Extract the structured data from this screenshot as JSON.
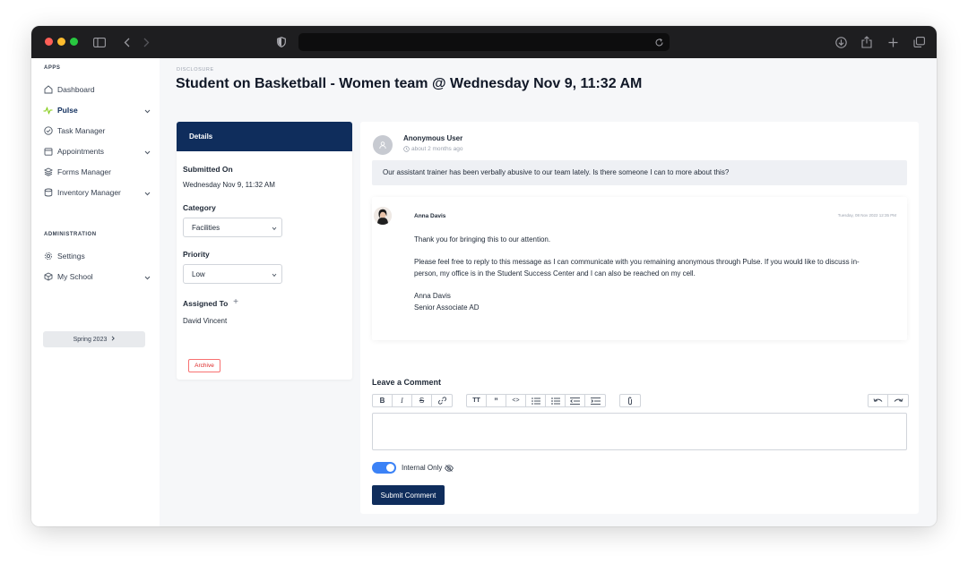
{
  "sidebar": {
    "apps_heading": "APPS",
    "items": [
      {
        "label": "Dashboard",
        "icon": "home-icon"
      },
      {
        "label": "Pulse",
        "icon": "pulse-icon"
      },
      {
        "label": "Task Manager",
        "icon": "check-circle-icon"
      },
      {
        "label": "Appointments",
        "icon": "calendar-icon"
      },
      {
        "label": "Forms Manager",
        "icon": "layers-icon"
      },
      {
        "label": "Inventory Manager",
        "icon": "database-icon"
      }
    ],
    "admin_heading": "ADMINISTRATION",
    "admin_items": [
      {
        "label": "Settings",
        "icon": "gear-icon"
      },
      {
        "label": "My School",
        "icon": "cube-icon"
      }
    ],
    "semester": "Spring 2023"
  },
  "header": {
    "eyebrow": "DISCLOSURE",
    "title": "Student on Basketball - Women team @ Wednesday Nov 9, 11:32 AM"
  },
  "details": {
    "tab_label": "Details",
    "submitted_on_label": "Submitted On",
    "submitted_on_value": "Wednesday Nov 9, 11:32 AM",
    "category_label": "Category",
    "category_value": "Facilities",
    "priority_label": "Priority",
    "priority_value": "Low",
    "assigned_to_label": "Assigned To",
    "assigned_to_value": "David Vincent",
    "archive_label": "Archive"
  },
  "thread": {
    "anon_name": "Anonymous User",
    "anon_time": "about 2 months ago",
    "anon_message": "Our assistant trainer has been verbally abusive to our team lately. Is there someone I can to more about this?",
    "reply": {
      "name": "Anna Davis",
      "timestamp": "Tuesday, 08 Nov 2022 12:35 PM",
      "line1": "Thank you for bringing this to our attention.",
      "line2": "Please feel free to reply to this message as I can communicate with you remaining anonymous through Pulse.  If you would like to discuss in-",
      "line3": "person, my office is in the Student Success Center and I can also be reached on my cell.",
      "sig_name": "Anna Davis",
      "sig_title": "Senior Associate AD"
    }
  },
  "comment": {
    "label": "Leave a Comment",
    "toggle_label": "Internal Only",
    "toggle_on": true,
    "submit_label": "Submit Comment"
  },
  "colors": {
    "brand_navy": "#0f2d5c",
    "toggle_blue": "#3b82f6",
    "archive_red": "#dc2626"
  }
}
